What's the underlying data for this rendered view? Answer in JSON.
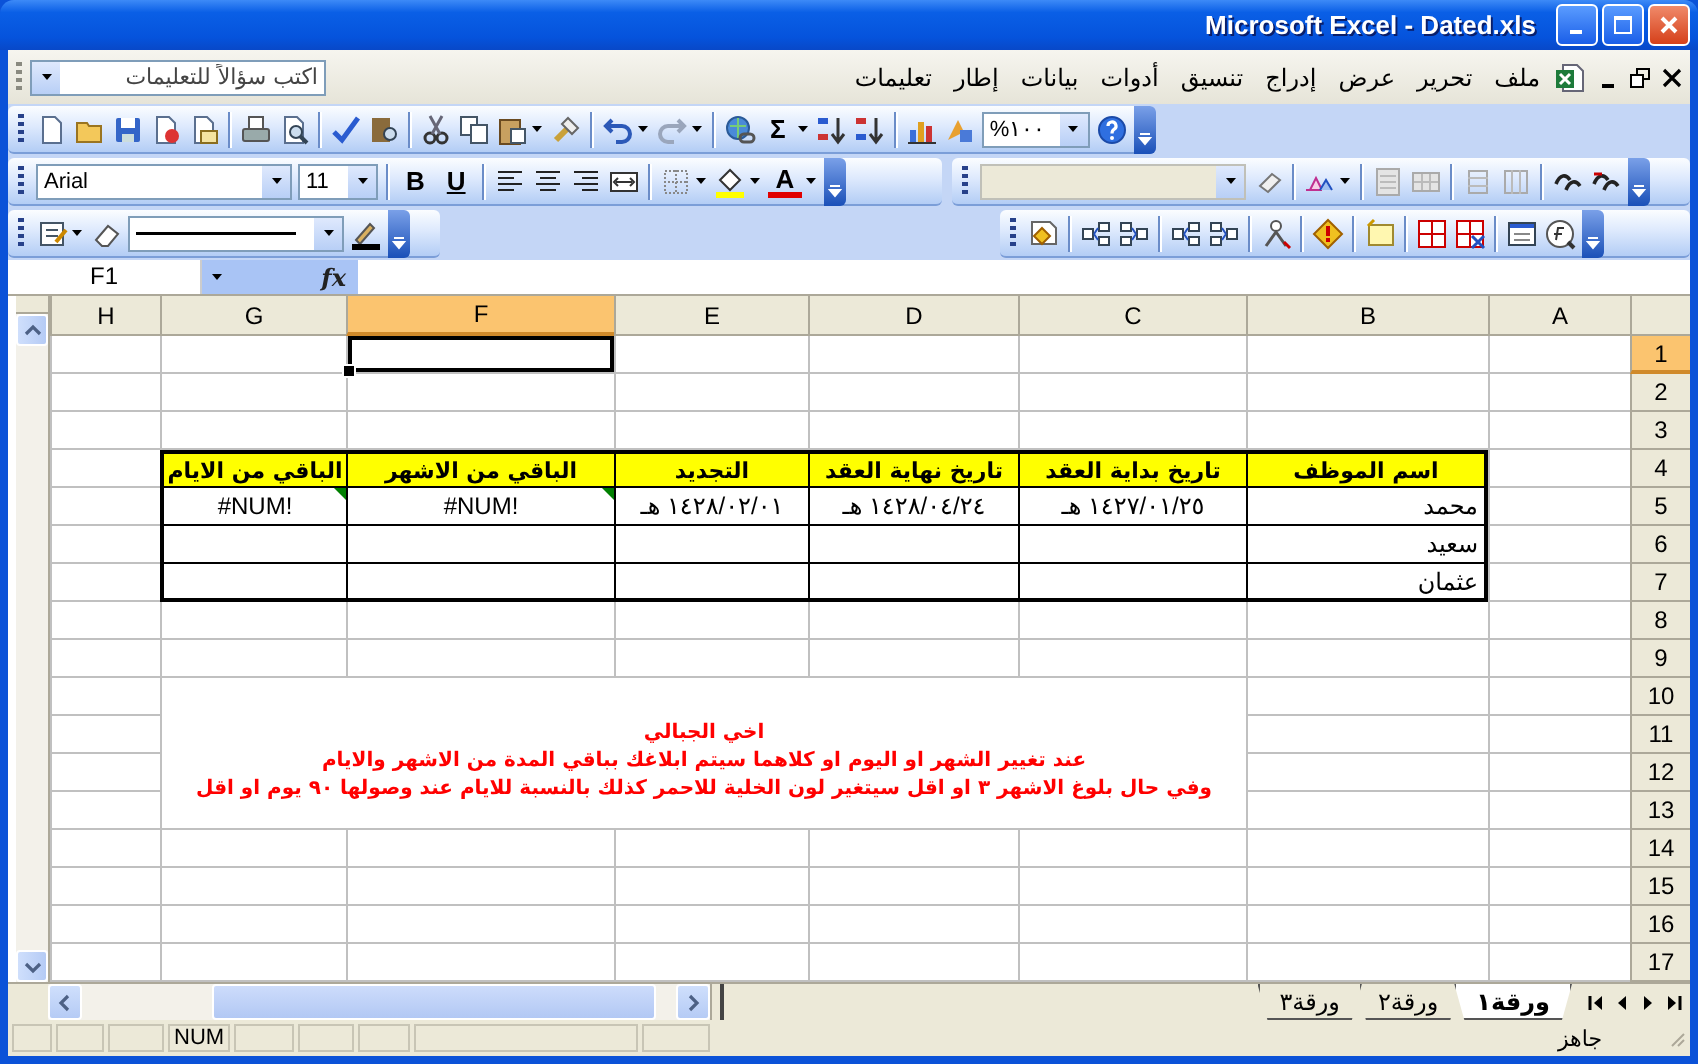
{
  "window": {
    "title": "Microsoft Excel - Dated.xls"
  },
  "menu_bar": {
    "items": [
      "ملف",
      "تحرير",
      "عرض",
      "إدراج",
      "تنسيق",
      "أدوات",
      "بيانات",
      "إطار",
      "تعليمات"
    ],
    "help_box": {
      "placeholder": "اكتب سؤالاً للتعليمات"
    }
  },
  "standard_toolbar": {
    "sum_label": "Σ",
    "zoom": "%١٠٠"
  },
  "formatting_toolbar": {
    "font": "Arial",
    "size": "11",
    "bold_label": "B",
    "underline_label": "U",
    "font_color_label": "A"
  },
  "formula_bar": {
    "name_box": "F1",
    "function_label": "fx"
  },
  "sheet": {
    "columns": [
      {
        "label": "A",
        "selected": false
      },
      {
        "label": "B",
        "selected": false
      },
      {
        "label": "C",
        "selected": false
      },
      {
        "label": "D",
        "selected": false
      },
      {
        "label": "E",
        "selected": false
      },
      {
        "label": "F",
        "selected": true
      },
      {
        "label": "G",
        "selected": false
      },
      {
        "label": "H",
        "selected": false
      }
    ],
    "rows": [
      {
        "label": "1",
        "selected": true
      },
      {
        "label": "2",
        "selected": false
      },
      {
        "label": "3",
        "selected": false
      },
      {
        "label": "4",
        "selected": false
      },
      {
        "label": "5",
        "selected": false
      },
      {
        "label": "6",
        "selected": false
      },
      {
        "label": "7",
        "selected": false
      },
      {
        "label": "8",
        "selected": false
      },
      {
        "label": "9",
        "selected": false
      },
      {
        "label": "10",
        "selected": false
      },
      {
        "label": "11",
        "selected": false
      },
      {
        "label": "12",
        "selected": false
      },
      {
        "label": "13",
        "selected": false
      },
      {
        "label": "14",
        "selected": false
      },
      {
        "label": "15",
        "selected": false
      },
      {
        "label": "16",
        "selected": false
      },
      {
        "label": "17",
        "selected": false
      }
    ],
    "table": {
      "headers": [
        "اسم الموظف",
        "تاريخ بداية العقد",
        "تاريخ نهاية العقد",
        "التجديد",
        "الباقي من الاشهر",
        "الباقي من الايام"
      ],
      "rows": [
        {
          "employee": "محمد",
          "contract_start": "١٤٢٧/٠١/٢٥ هـ",
          "contract_end": "١٤٢٨/٠٤/٢٤ هـ",
          "renewal": "١٤٢٨/٠٢/٠١ هـ",
          "months_left": "#NUM!",
          "days_left": "#NUM!",
          "error_marked": true
        },
        {
          "employee": "سعيد",
          "error_marked": false
        },
        {
          "employee": "عثمان",
          "error_marked": false
        }
      ]
    },
    "note": {
      "lines": [
        "اخي الجبالي",
        "عند تغيير الشهر او اليوم او كلاهما سيتم ابلاغك بباقي المدة من الاشهر والايام",
        "وفي حال بلوغ الاشهر ٣ او اقل سيتغير لون الخلية للاحمر كذلك بالنسبة للايام عند وصولها ٩٠ يوم او اقل"
      ]
    }
  },
  "sheet_tabs": [
    {
      "label": "ورقة١",
      "selected": true
    },
    {
      "label": "ورقة٢",
      "selected": false
    },
    {
      "label": "ورقة٣",
      "selected": false
    }
  ],
  "status_bar": {
    "status": "جاهز",
    "indicators": [
      "NUM"
    ]
  }
}
